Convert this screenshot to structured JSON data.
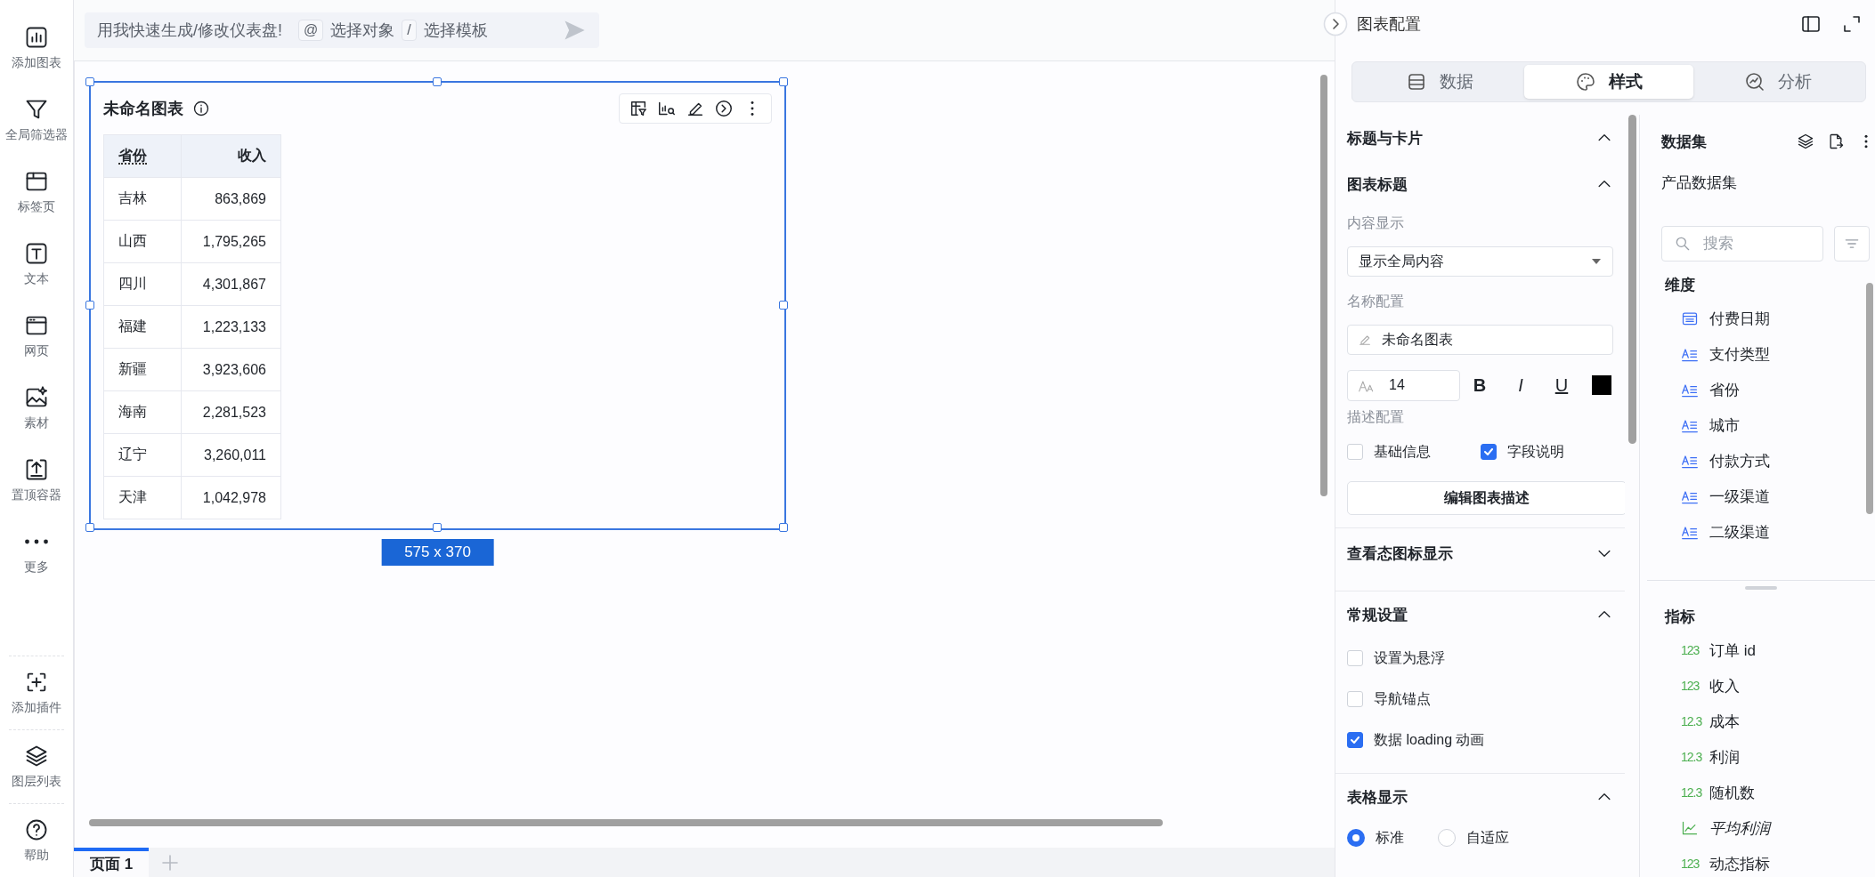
{
  "sidebar": {
    "top_items": [
      {
        "label": "添加图表"
      },
      {
        "label": "全局筛选器"
      },
      {
        "label": "标签页"
      },
      {
        "label": "文本"
      },
      {
        "label": "网页"
      },
      {
        "label": "素材"
      },
      {
        "label": "置顶容器"
      },
      {
        "label": "更多"
      }
    ],
    "bottom_items": [
      {
        "label": "添加插件"
      },
      {
        "label": "图层列表"
      },
      {
        "label": "帮助"
      }
    ]
  },
  "ai_bar": {
    "placeholder": "用我快速生成/修改仪表盘!",
    "mention_key": "@",
    "mention_label": "选择对象",
    "template_key": "/",
    "template_label": "选择模板"
  },
  "chart_card": {
    "title": "未命名图表",
    "size_label": "575 x 370",
    "table": {
      "columns": [
        "省份",
        "收入"
      ],
      "rows": [
        [
          "吉林",
          "863,869"
        ],
        [
          "山西",
          "1,795,265"
        ],
        [
          "四川",
          "4,301,867"
        ],
        [
          "福建",
          "1,223,133"
        ],
        [
          "新疆",
          "3,923,606"
        ],
        [
          "海南",
          "2,281,523"
        ],
        [
          "辽宁",
          "3,260,011"
        ],
        [
          "天津",
          "1,042,978"
        ]
      ]
    }
  },
  "page_tabs": [
    {
      "label": "页面 1",
      "selected": true
    }
  ],
  "config": {
    "title": "图表配置",
    "tabs": [
      {
        "label": "数据",
        "selected": false
      },
      {
        "label": "样式",
        "selected": true
      },
      {
        "label": "分析",
        "selected": false
      }
    ],
    "title_card": {
      "heading": "标题与卡片",
      "expanded": true
    },
    "chart_title": {
      "heading": "图表标题",
      "expanded": true,
      "content_label": "内容显示",
      "content_value": "显示全局内容",
      "name_label": "名称配置",
      "name_value": "未命名图表",
      "font_size": "14",
      "bold_key": "B",
      "italic_key": "I",
      "underline_key": "U",
      "desc_label": "描述配置",
      "desc_options": [
        {
          "label": "基础信息",
          "checked": false
        },
        {
          "label": "字段说明",
          "checked": true
        }
      ],
      "edit_button": "编辑图表描述"
    },
    "view_icons": {
      "heading": "查看态图标显示",
      "expanded": false
    },
    "general": {
      "heading": "常规设置",
      "expanded": true,
      "options": [
        {
          "label": "设置为悬浮",
          "checked": false
        },
        {
          "label": "导航锚点",
          "checked": false
        },
        {
          "label": "数据 loading 动画",
          "checked": true
        }
      ]
    },
    "table_display": {
      "heading": "表格显示",
      "expanded": true,
      "options": [
        {
          "label": "标准",
          "selected": true
        },
        {
          "label": "自适应",
          "selected": false
        }
      ]
    }
  },
  "dataset": {
    "heading": "数据集",
    "name": "产品数据集",
    "search_placeholder": "搜索",
    "dimensions": {
      "heading": "维度",
      "items": [
        {
          "label": "付费日期",
          "kind": "date"
        },
        {
          "label": "支付类型",
          "kind": "text"
        },
        {
          "label": "省份",
          "kind": "text"
        },
        {
          "label": "城市",
          "kind": "text"
        },
        {
          "label": "付款方式",
          "kind": "text"
        },
        {
          "label": "一级渠道",
          "kind": "text"
        },
        {
          "label": "二级渠道",
          "kind": "text"
        }
      ]
    },
    "measures": {
      "heading": "指标",
      "items": [
        {
          "label": "订单 id",
          "kind": "number",
          "badge": "123"
        },
        {
          "label": "收入",
          "kind": "number",
          "badge": "123"
        },
        {
          "label": "成本",
          "kind": "number",
          "badge": "12.3"
        },
        {
          "label": "利润",
          "kind": "number",
          "badge": "12.3"
        },
        {
          "label": "随机数",
          "kind": "number",
          "badge": "12.3"
        },
        {
          "label": "平均利润",
          "kind": "calculated"
        },
        {
          "label": "动态指标",
          "kind": "number",
          "badge": "123"
        }
      ]
    }
  }
}
